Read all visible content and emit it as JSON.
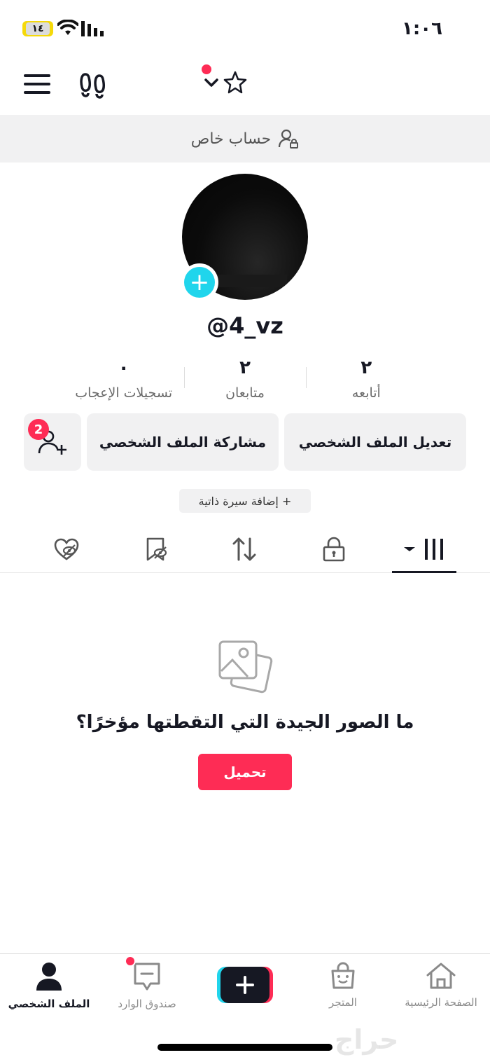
{
  "status_bar": {
    "time": "١:٠٦",
    "battery": "١٤"
  },
  "private_banner": {
    "text": "حساب خاص"
  },
  "profile": {
    "username": "@4_vz"
  },
  "stats": [
    {
      "value": "٢",
      "label": "أتابعه"
    },
    {
      "value": "٢",
      "label": "متابعان"
    },
    {
      "value": "٠",
      "label": "تسجيلات الإعجاب"
    }
  ],
  "actions": {
    "edit_profile": "تعديل الملف الشخصي",
    "share_profile": "مشاركة الملف الشخصي",
    "friend_requests_badge": "2"
  },
  "bio": {
    "add_bio": "+ إضافة سيرة ذاتية"
  },
  "empty_state": {
    "text": "ما الصور الجيدة التي التقطتها مؤخرًا؟",
    "upload_button": "تحميل"
  },
  "bottom_nav": {
    "home": "الصفحة الرئيسية",
    "shop": "المتجر",
    "inbox": "صندوق الوارد",
    "profile": "الملف الشخصي"
  },
  "watermark": "حراج",
  "colors": {
    "accent": "#fe2c55",
    "cyan": "#20d5ec",
    "text": "#161823",
    "button_bg": "#f1f1f2"
  }
}
